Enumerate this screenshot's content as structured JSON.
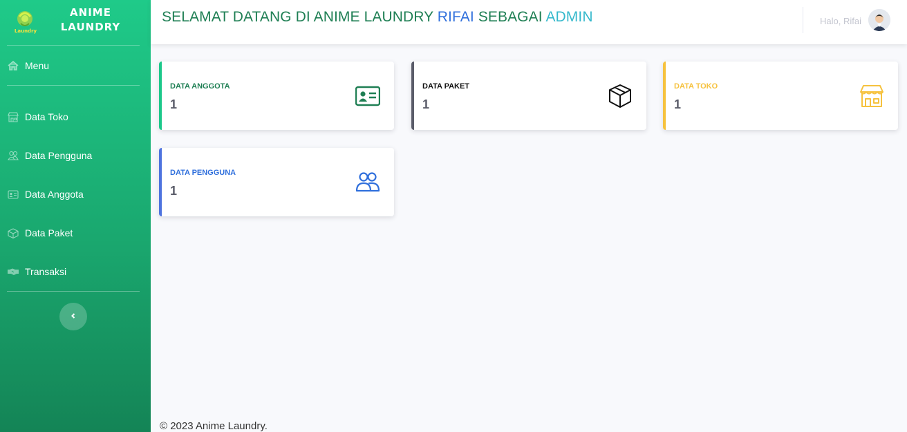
{
  "sidebar": {
    "brand_line1": "ANIME",
    "brand_line2": "LAUNDRY",
    "logo_text": "Laundry",
    "items": [
      {
        "label": "Menu",
        "icon": "home-icon"
      },
      {
        "label": "Data Toko",
        "icon": "store-icon"
      },
      {
        "label": "Data Pengguna",
        "icon": "users-icon"
      },
      {
        "label": "Data Anggota",
        "icon": "id-card-icon"
      },
      {
        "label": "Data Paket",
        "icon": "box-icon"
      },
      {
        "label": "Transaksi",
        "icon": "handshake-icon"
      }
    ],
    "toggle_icon": "chevron-left-icon"
  },
  "topbar": {
    "welcome_prefix": "SELAMAT DATANG DI ANIME LAUNDRY ",
    "user_name": "RIFAI",
    "welcome_mid": " SEBAGAI ",
    "role": "ADMIN",
    "greeting": "Halo, Rifai"
  },
  "cards": [
    {
      "title": "DATA ANGGOTA",
      "value": "1",
      "color": "#1f7f54",
      "icon": "id-card-icon"
    },
    {
      "title": "DATA PAKET",
      "value": "1",
      "color": "#111111",
      "accent": "#5a5c69",
      "icon": "box-icon"
    },
    {
      "title": "DATA TOKO",
      "value": "1",
      "color": "#f6c23e",
      "icon": "store-icon"
    },
    {
      "title": "DATA PENGGUNA",
      "value": "1",
      "color": "#2f6fdc",
      "accent": "#4e73df",
      "icon": "users-icon"
    }
  ],
  "colors": {
    "sidebar_top": "#1fca89",
    "sidebar_bottom": "#148456",
    "welcome": "#1f7f54",
    "name": "#2f6fdc",
    "role": "#36b9cc"
  },
  "footer": {
    "text": "© 2023 Anime Laundry."
  }
}
